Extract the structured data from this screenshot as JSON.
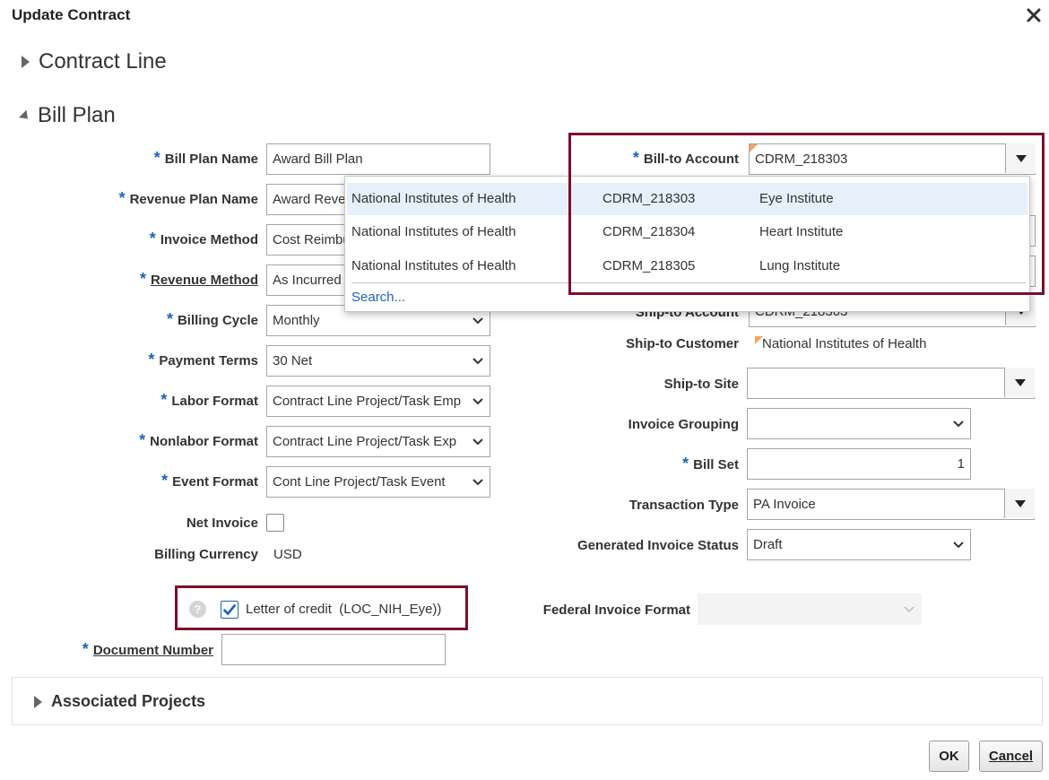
{
  "dialog": {
    "title": "Update Contract"
  },
  "sections": {
    "contract_line": "Contract Line",
    "bill_plan": "Bill Plan",
    "associated_projects": "Associated Projects"
  },
  "left_fields": [
    {
      "label": "Bill Plan Name",
      "value": "Award Bill Plan",
      "required": "*"
    },
    {
      "label": "Revenue Plan Name",
      "value": "Award Reve",
      "required": "*"
    },
    {
      "label": "Invoice Method",
      "value": "Cost Reimbu",
      "required": "*"
    },
    {
      "label": "Revenue Method",
      "value": "As Incurred",
      "required": "*"
    },
    {
      "label": "Billing Cycle",
      "value": "Monthly",
      "required": "*"
    },
    {
      "label": "Payment Terms",
      "value": "30 Net",
      "required": "*"
    },
    {
      "label": "Labor Format",
      "value": "Contract Line Project/Task Emp",
      "required": "*"
    },
    {
      "label": "Nonlabor Format",
      "value": "Contract Line Project/Task Exp",
      "required": "*"
    },
    {
      "label": "Event Format",
      "value": "Cont Line Project/Task Event",
      "required": "*"
    }
  ],
  "net_invoice": {
    "label": "Net Invoice"
  },
  "billing_currency": {
    "label": "Billing Currency",
    "value": "USD"
  },
  "letter_of_credit": {
    "label": "Letter of credit",
    "value": "(LOC_NIH_Eye))",
    "help": "?"
  },
  "document_number": {
    "label": "Document Number",
    "value": "",
    "required": "*"
  },
  "right_fields": {
    "bill_to_account": {
      "label": "Bill-to Account",
      "value": "CDRM_218303",
      "required": "*"
    },
    "ship_to_account": {
      "label": "Ship-to Account",
      "value": "CDRM_218303"
    },
    "ship_to_customer": {
      "label": "Ship-to Customer",
      "value": "National Institutes of Health"
    },
    "ship_to_site": {
      "label": "Ship-to Site",
      "value": ""
    },
    "invoice_grouping": {
      "label": "Invoice Grouping",
      "value": ""
    },
    "bill_set": {
      "label": "Bill Set",
      "value": "1",
      "required": "*"
    },
    "transaction_type": {
      "label": "Transaction Type",
      "value": "PA Invoice"
    },
    "generated_invoice_status": {
      "label": "Generated Invoice Status",
      "value": "Draft"
    },
    "federal_invoice_format": {
      "label": "Federal Invoice Format",
      "value": ""
    }
  },
  "dropdown": {
    "rows": [
      {
        "customer": "National Institutes of Health",
        "account": "CDRM_218303",
        "site": "Eye Institute"
      },
      {
        "customer": "National Institutes of Health",
        "account": "CDRM_218304",
        "site": "Heart Institute"
      },
      {
        "customer": "National Institutes of Health",
        "account": "CDRM_218305",
        "site": "Lung Institute"
      }
    ],
    "search_link": "Search..."
  },
  "buttons": {
    "ok": "OK",
    "cancel": "Cancel"
  },
  "colors": {
    "accent": "#1f64b7",
    "highlight": "#7b0f2a",
    "flag": "#f4a460"
  }
}
